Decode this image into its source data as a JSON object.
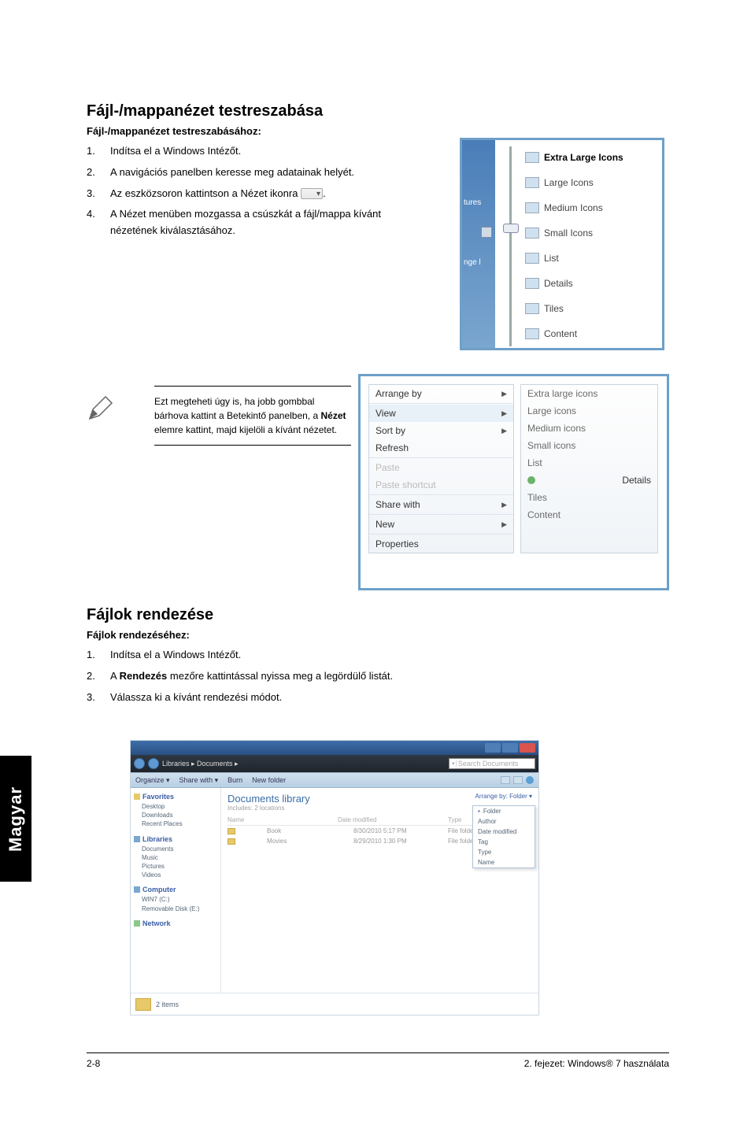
{
  "section1": {
    "title": "Fájl-/mappanézet testreszabása",
    "subtitle": "Fájl-/mappanézet testreszabásához:",
    "steps": [
      "Indítsa el a Windows Intézőt.",
      "A navigációs panelben keresse meg adatainak helyét.",
      "Az eszközsoron kattintson a Nézet ikonra",
      "A Nézet menüben mozgassa a csúszkát a fájl/mappa kívánt nézetének kiválasztásához."
    ],
    "step3_suffix": "."
  },
  "views_menu": {
    "left_labels": {
      "top": "tures",
      "bottom": "nge l"
    },
    "items": [
      "Extra Large Icons",
      "Large Icons",
      "Medium Icons",
      "Small Icons",
      "List",
      "Details",
      "Tiles",
      "Content"
    ]
  },
  "note": {
    "line1": "Ezt megteheti úgy is, ha jobb gombbal bárhova kattint a Betekintő panelben, a ",
    "bold": "Nézet",
    "line2": " elemre kattint, majd kijelöli a kívánt nézetet."
  },
  "context_menu": {
    "left": [
      "Arrange by",
      "View",
      "Sort by",
      "Refresh",
      "Paste",
      "Paste shortcut",
      "Share with",
      "New",
      "Properties"
    ],
    "right": [
      "Extra large icons",
      "Large icons",
      "Medium icons",
      "Small icons",
      "List",
      "Details",
      "Tiles",
      "Content"
    ]
  },
  "section2": {
    "title": "Fájlok rendezése",
    "subtitle": "Fájlok rendezéséhez:",
    "steps": [
      "Indítsa el a Windows Intézőt.",
      "",
      "Válassza ki a kívánt rendezési módot."
    ],
    "step2_pre": "A ",
    "step2_bold": "Rendezés",
    "step2_post": " mezőre kattintással nyissa meg a legördülő listát."
  },
  "explorer": {
    "breadcrumb": "Libraries ▸ Documents ▸",
    "search_placeholder": "Search Documents",
    "toolbar": [
      "Organize ▾",
      "Share with ▾",
      "Burn",
      "New folder"
    ],
    "sidebar": {
      "favorites": {
        "label": "Favorites",
        "items": [
          "Desktop",
          "Downloads",
          "Recent Places"
        ]
      },
      "libraries": {
        "label": "Libraries",
        "items": [
          "Documents",
          "Music",
          "Pictures",
          "Videos"
        ]
      },
      "computer": {
        "label": "Computer",
        "items": [
          "WIN7 (C:)",
          "Removable Disk (E:)"
        ]
      },
      "network": {
        "label": "Network"
      }
    },
    "main": {
      "heading": "Documents library",
      "subheading": "Includes: 2 locations",
      "arrange_label": "Arrange by:  Folder ▾",
      "columns": [
        "Name",
        "Date modified",
        "Type"
      ],
      "rows": [
        {
          "name": "Book",
          "date": "8/30/2010 5:17 PM",
          "type": "File folder"
        },
        {
          "name": "Movies",
          "date": "8/29/2010 1:30 PM",
          "type": "File folder"
        }
      ],
      "dropdown": [
        "Folder",
        "Author",
        "Date modified",
        "Tag",
        "Type",
        "Name"
      ]
    },
    "status": "2 items"
  },
  "side_tab": "Magyar",
  "footer": {
    "left": "2-8",
    "right": "2. fejezet: Windows® 7 használata"
  }
}
